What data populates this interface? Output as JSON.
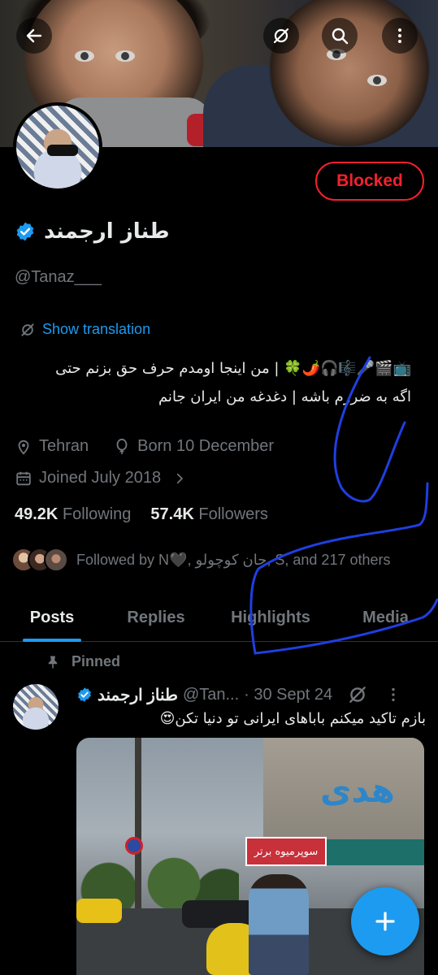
{
  "profile": {
    "name": "طناز ارجمند",
    "handle": "@Tanaz___",
    "blocked_label": "Blocked",
    "translate_label": "Show translation",
    "bio_line1": "📺🎬🎤🎼🎧🌶️🍀 | من اینجا اومدم حرف حق بزنم حتی",
    "bio_line2": "اگه به ضررم باشه | دغدغه من ایران جانم",
    "location": "Tehran",
    "born": "Born 10 December",
    "joined": "Joined July 2018",
    "following_count": "49.2K",
    "following_label": "Following",
    "followers_count": "57.4K",
    "followers_label": "Followers",
    "followed_by": "Followed by N🖤, جان کوچولو, S, and 217 others"
  },
  "tabs": [
    {
      "label": "Posts",
      "active": true
    },
    {
      "label": "Replies",
      "active": false
    },
    {
      "label": "Highlights",
      "active": false
    },
    {
      "label": "Media",
      "active": false
    }
  ],
  "pinned_post": {
    "pinned_label": "Pinned",
    "author": "طناز ارجمند",
    "handle": "@Tan...",
    "date": "· 30 Sept 24",
    "text": "بازم تاکید میکنم باباهای ایرانی تو دنیا تکن😍",
    "photo": {
      "sign_text": "هدی",
      "shop_sign": "سوپرمیوه برتر"
    }
  },
  "icons": {
    "back": "arrow-left-icon",
    "grok": "grok-icon",
    "search": "search-icon",
    "more": "more-vertical-icon",
    "verified": "verified-badge-icon",
    "location": "location-pin-icon",
    "birthday": "balloon-icon",
    "calendar": "calendar-icon",
    "chevron": "chevron-right-icon",
    "pin": "pin-icon",
    "compose": "plus-icon"
  },
  "colors": {
    "accent": "#1d9bf0",
    "blocked": "#f4212e",
    "muted": "#71767b",
    "annotation": "#1f3fe0"
  }
}
